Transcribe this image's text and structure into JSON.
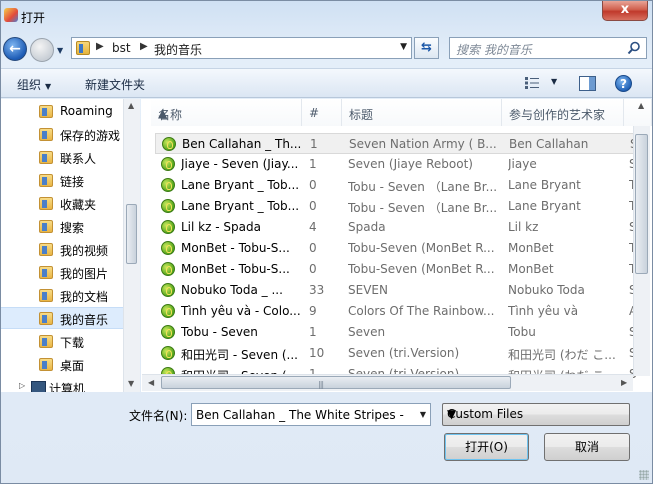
{
  "window": {
    "title": "打开",
    "close_label": "x"
  },
  "nav": {
    "back_label": "←"
  },
  "address": {
    "parts": [
      "bst",
      "我的音乐"
    ]
  },
  "search": {
    "placeholder": "搜索 我的音乐"
  },
  "toolbar": {
    "organize_label": "组织",
    "new_folder_label": "新建文件夹"
  },
  "sidebar": {
    "items": [
      {
        "label": "Roaming"
      },
      {
        "label": "保存的游戏"
      },
      {
        "label": "联系人"
      },
      {
        "label": "链接"
      },
      {
        "label": "收藏夹"
      },
      {
        "label": "搜索"
      },
      {
        "label": "我的视频"
      },
      {
        "label": "我的图片"
      },
      {
        "label": "我的文档"
      },
      {
        "label": "我的音乐",
        "selected": true
      },
      {
        "label": "下载"
      },
      {
        "label": "桌面"
      },
      {
        "label": "计算机"
      }
    ]
  },
  "columns": {
    "name": "名称",
    "num": "#",
    "title": "标题",
    "artist": "参与创作的艺术家"
  },
  "files": [
    {
      "name": "Ben Callahan _ Th...",
      "num": "1",
      "title": "Seven Nation Army ( B...",
      "artist": "Ben Callahan",
      "extra": "S"
    },
    {
      "name": "Jiaye - Seven (Jiay...",
      "num": "1",
      "title": "Seven (Jiaye Reboot)",
      "artist": "Jiaye",
      "extra": "S"
    },
    {
      "name": "Lane Bryant _ Tob...",
      "num": "0",
      "title": "Tobu - Seven （Lane Br...",
      "artist": "Lane Bryant",
      "extra": "T"
    },
    {
      "name": "Lane Bryant _ Tob...",
      "num": "0",
      "title": "Tobu - Seven （Lane Br...",
      "artist": "Lane Bryant",
      "extra": "T"
    },
    {
      "name": "Lil kz - Spada",
      "num": "4",
      "title": "Spada",
      "artist": "Lil kz",
      "extra": "S"
    },
    {
      "name": "MonBet - Tobu-S...",
      "num": "0",
      "title": "Tobu-Seven (MonBet R...",
      "artist": "MonBet",
      "extra": "T"
    },
    {
      "name": "MonBet - Tobu-S...",
      "num": "0",
      "title": "Tobu-Seven (MonBet R...",
      "artist": "MonBet",
      "extra": "T"
    },
    {
      "name": "Nobuko Toda _ ...",
      "num": "33",
      "title": "SEVEN",
      "artist": "Nobuko Toda",
      "extra": "S"
    },
    {
      "name": "Tình yêu và - Colo...",
      "num": "9",
      "title": "Colors Of The Rainbow...",
      "artist": "Tình yêu và",
      "extra": "A"
    },
    {
      "name": "Tobu - Seven",
      "num": "1",
      "title": "Seven",
      "artist": "Tobu",
      "extra": "S"
    },
    {
      "name": "和田光司 - Seven (...",
      "num": "10",
      "title": "Seven (tri.Version)",
      "artist": "和田光司 (わだ こ...",
      "extra": "S"
    },
    {
      "name": "和田光司 - Seven (...",
      "num": "1",
      "title": "Seven (tri.Version)",
      "artist": "和田光司 (わだ こ...",
      "extra": "S"
    }
  ],
  "bottom": {
    "filename_label": "文件名(N):",
    "filename_value": "Ben Callahan _ The White Stripes - Se",
    "filetype": "Custom Files",
    "open_label": "打开(O)",
    "cancel_label": "取消"
  }
}
